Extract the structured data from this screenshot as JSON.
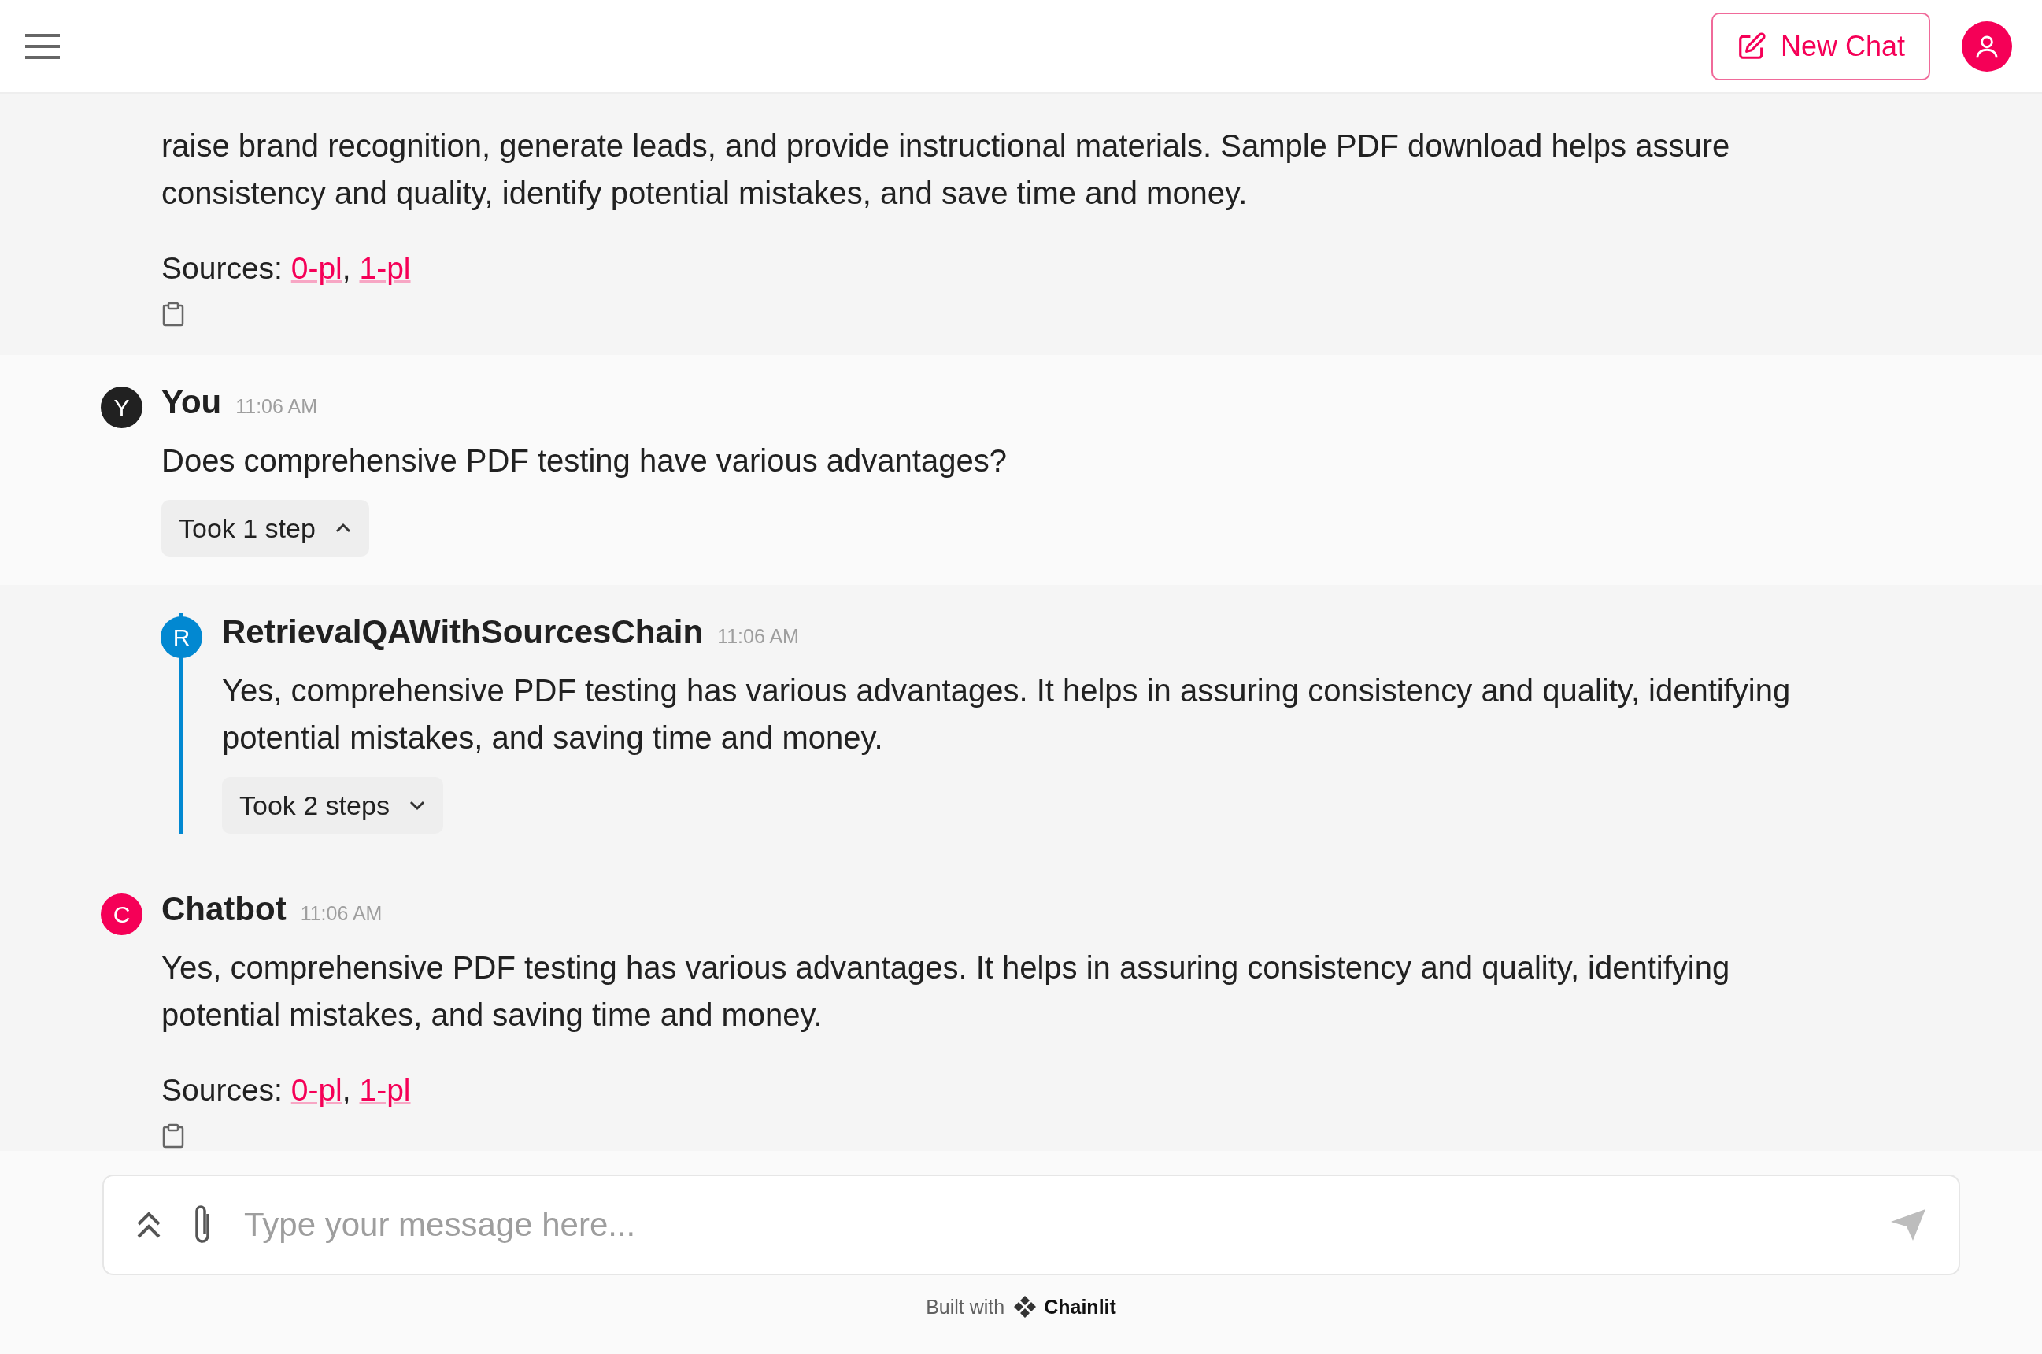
{
  "header": {
    "new_chat": "New Chat"
  },
  "messages": [
    {
      "text": "raise brand recognition, generate leads, and provide instructional materials. Sample PDF download helps assure consistency and quality, identify potential mistakes, and save time and money.",
      "sources": {
        "label": "Sources:",
        "separator": ",",
        "links": [
          "0-pl",
          "1-pl"
        ]
      }
    },
    {
      "avatar": "Y",
      "color": "#212121",
      "author": "You",
      "time": "11:06 AM",
      "text": "Does comprehensive PDF testing have various advantages?",
      "step": {
        "label": "Took 1 step",
        "expanded": true
      },
      "children": [
        {
          "avatar": "R",
          "color": "#0288d1",
          "author": "RetrievalQAWithSourcesChain",
          "time": "11:06 AM",
          "text": "Yes, comprehensive PDF testing has various advantages. It helps in assuring consistency and quality, identifying potential mistakes, and saving time and money.",
          "step": {
            "label": "Took 2 steps",
            "expanded": false
          }
        }
      ]
    },
    {
      "avatar": "C",
      "color": "#f50057",
      "author": "Chatbot",
      "time": "11:06 AM",
      "text": "Yes, comprehensive PDF testing has various advantages. It helps in assuring consistency and quality, identifying potential mistakes, and saving time and money.",
      "sources": {
        "label": "Sources:",
        "separator": ",",
        "links": [
          "0-pl",
          "1-pl"
        ]
      }
    }
  ],
  "composer": {
    "placeholder": "Type your message here..."
  },
  "footer": {
    "built_with": "Built with",
    "brand": "Chainlit"
  }
}
